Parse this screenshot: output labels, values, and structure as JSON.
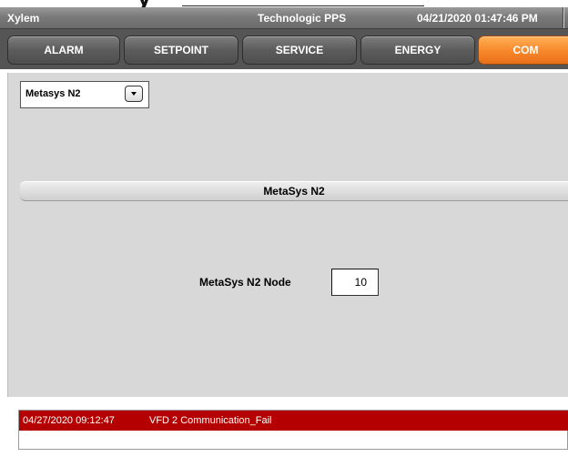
{
  "header": {
    "app_name": "Xylem",
    "system_name": "Technologic PPS",
    "datetime": "04/21/2020 01:47:46 PM"
  },
  "tabs": [
    {
      "label": "ALARM",
      "active": false
    },
    {
      "label": "SETPOINT",
      "active": false
    },
    {
      "label": "SERVICE",
      "active": false
    },
    {
      "label": "ENERGY",
      "active": false
    },
    {
      "label": "COM",
      "active": true
    }
  ],
  "protocol_select": {
    "value": "Metasys N2",
    "icon": "dropdown-arrow-icon"
  },
  "section": {
    "title": "MetaSys N2"
  },
  "node_field": {
    "label": "MetaSys N2 Node",
    "value": "10"
  },
  "alarm_log": [
    {
      "timestamp": "04/27/2020 09:12:47",
      "message": "VFD 2 Communication_Fail"
    }
  ],
  "colors": {
    "active_tab": "#f7872a",
    "alarm_row": "#b40000",
    "tab_bar": "#555555",
    "panel": "#d8d8d8"
  }
}
